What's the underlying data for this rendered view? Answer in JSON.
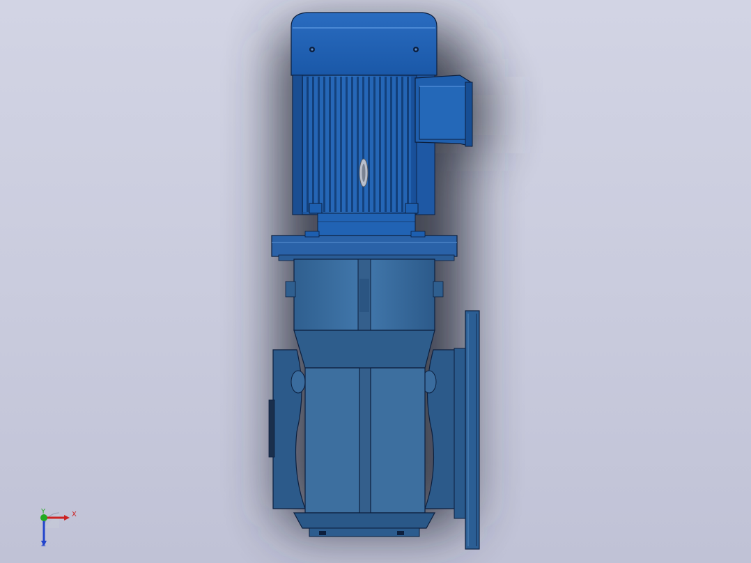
{
  "scene": {
    "subject": "gearmotor-3d-model",
    "background_color": "#cdd0e0",
    "body_color": "#3c6e9c",
    "motor_color": "#1d5fb0",
    "edge_color": "#0c1f3e"
  },
  "triad": {
    "x_label": "X",
    "y_label": "Y",
    "z_label": "Z",
    "x_color": "#cc2222",
    "y_color": "#22aa22",
    "z_color": "#2244cc"
  }
}
